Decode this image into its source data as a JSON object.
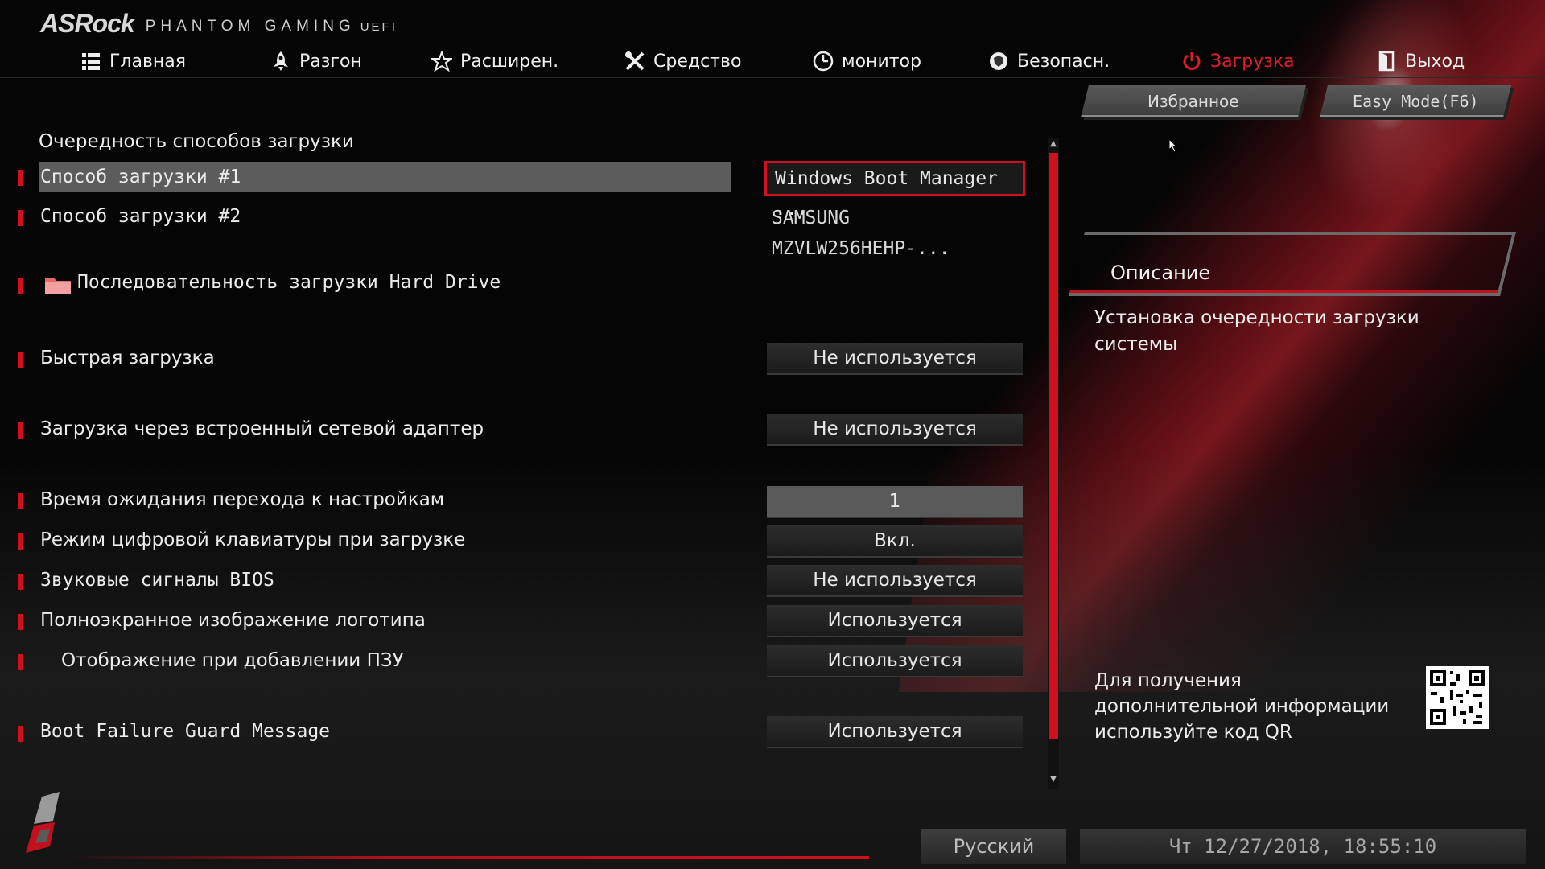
{
  "header": {
    "brand": "ASRock",
    "product": "PHANTOM GAMING",
    "uefi": "UEFI"
  },
  "nav": {
    "items": [
      {
        "label": "Главная",
        "icon": "list-icon"
      },
      {
        "label": "Разгон",
        "icon": "rocket-icon"
      },
      {
        "label": "Расширен.",
        "icon": "star-icon"
      },
      {
        "label": "Средство",
        "icon": "tools-icon"
      },
      {
        "label": "монитор",
        "icon": "monitor-gauge-icon"
      },
      {
        "label": "Безопасн.",
        "icon": "shield-icon"
      },
      {
        "label": "Загрузка",
        "icon": "power-icon",
        "active": true
      },
      {
        "label": "Выход",
        "icon": "exit-door-icon"
      }
    ],
    "active_color": "#e21b2c"
  },
  "top_buttons": {
    "favorites": "Избранное",
    "easy_mode": "Easy Mode(F6)"
  },
  "main": {
    "section_title": "Очередность способов загрузки",
    "rows": [
      {
        "label": "Способ загрузки #1",
        "value": "Windows Boot Manager ...",
        "selected": true
      },
      {
        "label": "Способ загрузки #2",
        "value": "SAMSUNG MZVLW256HEHP-..."
      },
      {
        "label": "Последовательность загрузки Hard Drive",
        "value": "",
        "icon": "folder-icon"
      },
      {
        "label": "Быстрая загрузка",
        "value": "Не используется"
      },
      {
        "label": "Загрузка через встроенный сетевой адаптер",
        "value": "Не используется"
      },
      {
        "label": "Время ожидания перехода к настройкам",
        "value": "1"
      },
      {
        "label": "Режим цифровой клавиатуры при загрузке",
        "value": "Вкл."
      },
      {
        "label": "Звуковые сигналы BIOS",
        "value": "Не используется"
      },
      {
        "label": "Полноэкранное изображение логотипа",
        "value": "Используется"
      },
      {
        "label": "Отображение при добавлении ПЗУ",
        "value": "Используется"
      },
      {
        "label": "Boot Failure Guard Message",
        "value": "Используется"
      }
    ]
  },
  "description": {
    "title": "Описание",
    "text": "Установка очередности загрузки системы"
  },
  "qr_info": {
    "text": "Для получения дополнительной информации используйте код QR"
  },
  "footer": {
    "language": "Русский",
    "datetime": "Чт 12/27/2018, 18:55:10"
  },
  "colors": {
    "accent_red": "#d0101e",
    "background": "#050505"
  }
}
